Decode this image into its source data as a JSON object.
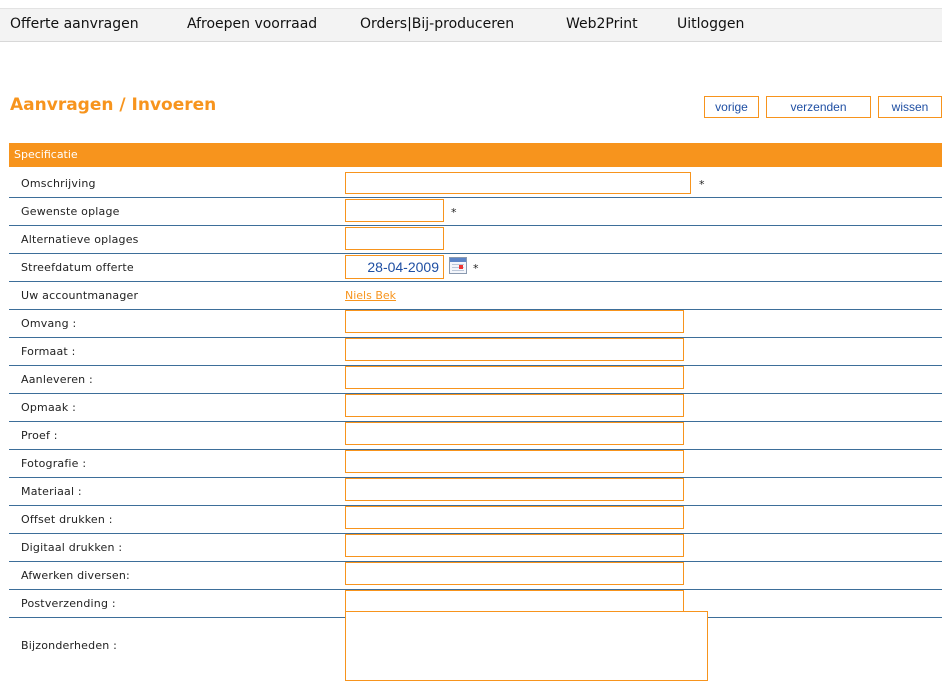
{
  "nav": {
    "items": [
      "Offerte aanvragen",
      "Afroepen voorraad",
      "Orders|Bij-produceren",
      "Web2Print",
      "Uitloggen"
    ]
  },
  "page": {
    "title": "Aanvragen / Invoeren"
  },
  "buttons": {
    "prev": "vorige",
    "send": "verzenden",
    "clear": "wissen"
  },
  "section": {
    "title": "Specificatie"
  },
  "form": {
    "required_marker": "*",
    "omschrijving": {
      "label": "Omschrijving",
      "value": ""
    },
    "oplage": {
      "label": "Gewenste oplage",
      "value": ""
    },
    "alt_oplages": {
      "label": "Alternatieve oplages",
      "value": ""
    },
    "streefdatum": {
      "label": "Streefdatum offerte",
      "value": "28-04-2009"
    },
    "accountmanager": {
      "label": "Uw accountmanager",
      "value": "Niels Bek"
    },
    "omvang": {
      "label": "Omvang :",
      "value": ""
    },
    "formaat": {
      "label": "Formaat :",
      "value": ""
    },
    "aanleveren": {
      "label": "Aanleveren :",
      "value": ""
    },
    "opmaak": {
      "label": "Opmaak :",
      "value": ""
    },
    "proef": {
      "label": "Proef :",
      "value": ""
    },
    "fotografie": {
      "label": "Fotografie :",
      "value": ""
    },
    "materiaal": {
      "label": "Materiaal :",
      "value": ""
    },
    "offset": {
      "label": "Offset drukken :",
      "value": ""
    },
    "digitaal": {
      "label": "Digitaal drukken :",
      "value": ""
    },
    "afwerken": {
      "label": "Afwerken diversen:",
      "value": ""
    },
    "postverzending": {
      "label": "Postverzending :",
      "value": ""
    },
    "bijzonderheden": {
      "label": "Bijzonderheden :",
      "value": ""
    }
  },
  "colors": {
    "accent": "#f7941d",
    "rule": "#3d6e99",
    "link_blue": "#1f4fa3"
  }
}
